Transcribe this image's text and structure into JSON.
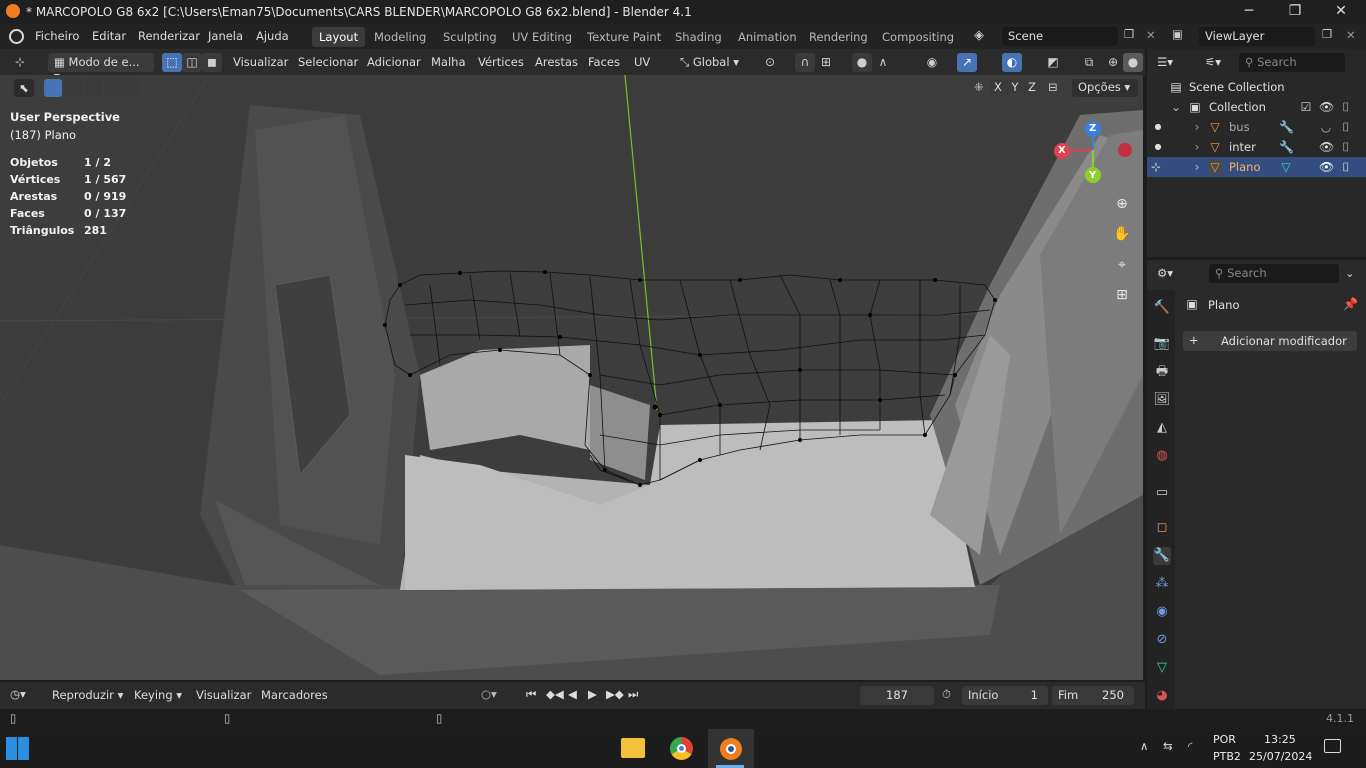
{
  "window": {
    "title": "* MARCOPOLO G8 6x2 [C:\\Users\\Eman75\\Documents\\CARS BLENDER\\MARCOPOLO G8 6x2.blend] - Blender 4.1",
    "minimize": "─",
    "maximize": "❐",
    "close": "✕"
  },
  "menu": [
    "Ficheiro",
    "Editar",
    "Renderizar",
    "Janela",
    "Ajuda"
  ],
  "workspaces": [
    "Layout",
    "Modeling",
    "Sculpting",
    "UV Editing",
    "Texture Paint",
    "Shading",
    "Animation",
    "Rendering",
    "Compositing"
  ],
  "scene": {
    "value": "Scene"
  },
  "viewlayer": {
    "value": "ViewLayer"
  },
  "viewport_header": {
    "mode": "Modo de e...",
    "menus": [
      "Visualizar",
      "Selecionar",
      "Adicionar",
      "Malha",
      "Vértices",
      "Arestas",
      "Faces",
      "UV"
    ],
    "orientation": "Global",
    "axes": [
      "X",
      "Y",
      "Z"
    ],
    "options": "Opções"
  },
  "viewport": {
    "perspective": "User Perspective",
    "object": "(187) Plano",
    "stats": [
      {
        "label": "Objetos",
        "value": "1 / 2"
      },
      {
        "label": "Vértices",
        "value": "1 / 567"
      },
      {
        "label": "Arestas",
        "value": "0 / 919"
      },
      {
        "label": "Faces",
        "value": "0 / 137"
      },
      {
        "label": "Triângulos",
        "value": "281"
      }
    ],
    "gizmo": {
      "x": "X",
      "y": "Y",
      "z": "Z"
    }
  },
  "outliner": {
    "search_placeholder": "Search",
    "scene_collection": "Scene Collection",
    "collection": "Collection",
    "items": [
      {
        "name": "bus",
        "selected": false
      },
      {
        "name": "inter",
        "selected": false
      },
      {
        "name": "Plano",
        "selected": true
      }
    ]
  },
  "properties": {
    "search_placeholder": "Search",
    "object_name": "Plano",
    "add_modifier": "Adicionar modificador"
  },
  "timeline": {
    "playback": "Reproduzir",
    "keying": "Keying",
    "view": "Visualizar",
    "markers": "Marcadores",
    "current_frame": "187",
    "start_label": "Início",
    "start": "1",
    "end_label": "Fim",
    "end": "250"
  },
  "statusbar": {
    "version": "4.1.1"
  },
  "taskbar": {
    "lang": "POR",
    "layout": "PTB2",
    "time": "13:25",
    "date": "25/07/2024"
  },
  "colors": {
    "accent": "#4772b3",
    "selected_row": "#334d80",
    "object_orange": "#e8964a",
    "axis_x": "#e04050",
    "axis_y": "#8ccf2a",
    "axis_z": "#3a7fdc"
  }
}
